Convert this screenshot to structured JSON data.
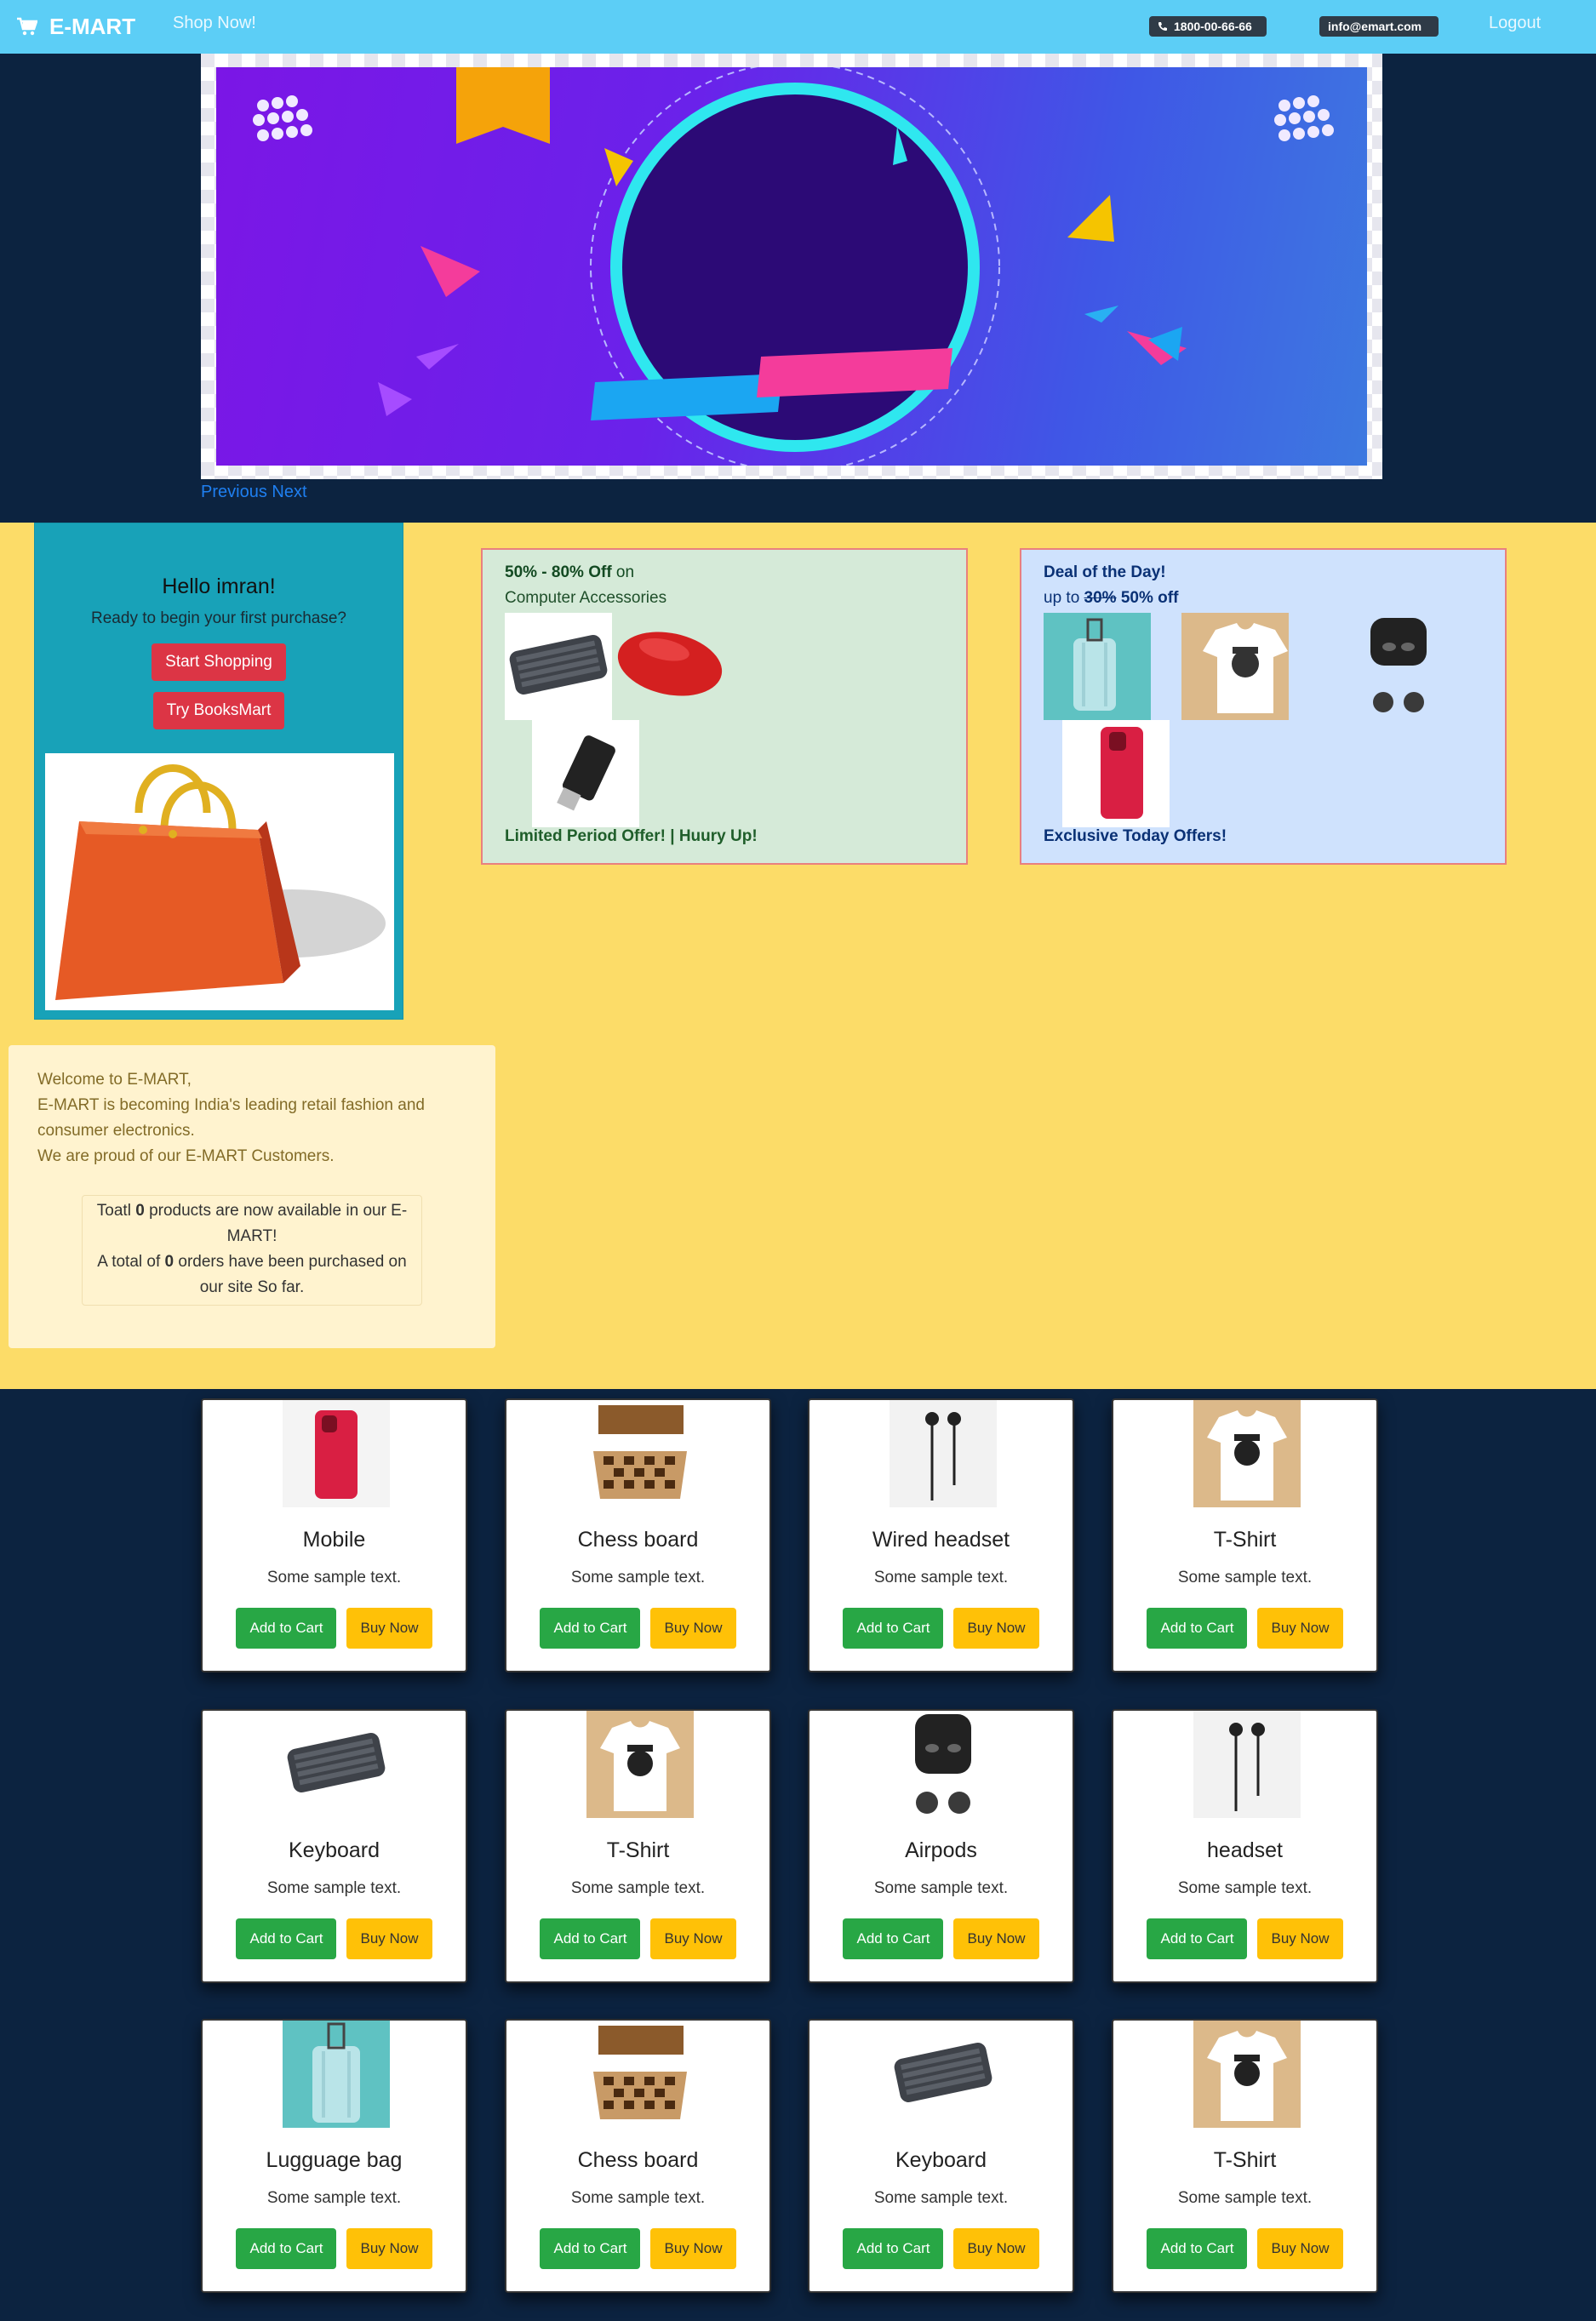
{
  "navbar": {
    "brand": "E-MART",
    "shop_now": "Shop Now!",
    "phone": "1800-00-66-66",
    "email": "info@emart.com",
    "logout": "Logout"
  },
  "carousel": {
    "previous": "Previous",
    "next": "Next"
  },
  "hello": {
    "title": "Hello imran!",
    "subtitle": "Ready to begin your first purchase?",
    "start_shopping": "Start Shopping",
    "try_booksmart": "Try BooksMart"
  },
  "offer_accessories": {
    "discount": "50% - 80% Off",
    "on": " on",
    "category": "Computer Accessories",
    "footer": "Limited Period Offer! | Huury Up!"
  },
  "offer_deal": {
    "title": "Deal of the Day!",
    "up_to": "up to ",
    "old_discount": "30%",
    "new_discount": " 50% off",
    "footer": "Exclusive Today Offers!"
  },
  "welcome": {
    "line1": "Welcome to E-MART,",
    "line2": "E-MART is becoming India's leading retail fashion and",
    "line3": "consumer electronics.",
    "line4": "We are proud of our E-MART Customers.",
    "stats_a1": "Toatl ",
    "products_count": "0",
    "stats_a2": " products are now available in our E-",
    "stats_a3": "MART!",
    "stats_b1": "A total of ",
    "orders_count": "0",
    "stats_b2": " orders have been purchased on",
    "stats_b3": "our site So far."
  },
  "product_buttons": {
    "add_to_cart": "Add to Cart",
    "buy_now": "Buy Now"
  },
  "products": [
    {
      "name": "Mobile",
      "text": "Some sample text."
    },
    {
      "name": "Chess board",
      "text": "Some sample text."
    },
    {
      "name": "Wired headset",
      "text": "Some sample text."
    },
    {
      "name": "T-Shirt",
      "text": "Some sample text."
    },
    {
      "name": "Keyboard",
      "text": "Some sample text."
    },
    {
      "name": "T-Shirt",
      "text": "Some sample text."
    },
    {
      "name": "Airpods",
      "text": "Some sample text."
    },
    {
      "name": "headset",
      "text": "Some sample text."
    },
    {
      "name": "Lugguage bag",
      "text": "Some sample text."
    },
    {
      "name": "Chess board",
      "text": "Some sample text."
    },
    {
      "name": "Keyboard",
      "text": "Some sample text."
    },
    {
      "name": "T-Shirt",
      "text": "Some sample text."
    }
  ],
  "icons": {
    "cart": "shopping-cart-icon",
    "phone": "phone-icon"
  },
  "colors": {
    "navbar": "#5ccef6",
    "page_bg": "#0c2340",
    "yellow_section": "#fcdc68",
    "hello_card": "#18a2b8",
    "btn_red": "#dc3545",
    "btn_green": "#28a745",
    "btn_yellow": "#ffc107"
  }
}
